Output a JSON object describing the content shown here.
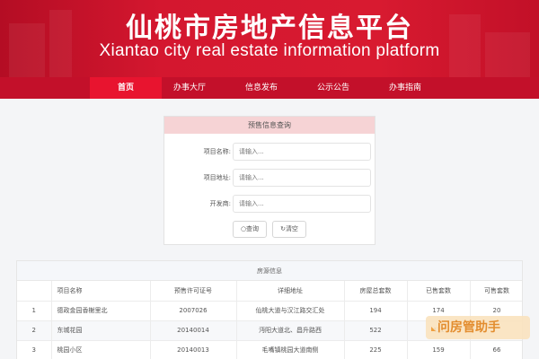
{
  "banner": {
    "title_cn": "仙桃市房地产信息平台",
    "title_en": "Xiantao city real estate information platform"
  },
  "nav": {
    "items": [
      "首页",
      "办事大厅",
      "信息发布",
      "公示公告",
      "办事指南"
    ],
    "active_index": 0
  },
  "search": {
    "title": "预售信息查询",
    "fields": [
      {
        "label": "项目名称:",
        "placeholder": "请输入..."
      },
      {
        "label": "项目地址:",
        "placeholder": "请输入..."
      },
      {
        "label": "开发商:",
        "placeholder": "请输入..."
      }
    ],
    "query_button": "查询",
    "clear_button": "清空"
  },
  "listing": {
    "caption": "房源信息",
    "columns": [
      "",
      "项目名称",
      "预售许可证号",
      "详细地址",
      "房屋总套数",
      "已售套数",
      "可售套数"
    ],
    "rows": [
      [
        "1",
        "德政金园香榭里北",
        "2007026",
        "仙桃大道与汉江路交汇处",
        "194",
        "174",
        "20"
      ],
      [
        "2",
        "东城花园",
        "20140014",
        "沔阳大道北、昌升路西",
        "522",
        "431",
        ""
      ],
      [
        "3",
        "桃园小区",
        "20140013",
        "毛嘴镇桃园大道南侧",
        "225",
        "159",
        "66"
      ]
    ]
  },
  "watermark": "问房管助手",
  "colors": {
    "brand_red": "#c3102a",
    "nav_active": "#e8142f",
    "search_header": "#f6d3d5",
    "watermark_text": "#e38d2f"
  }
}
